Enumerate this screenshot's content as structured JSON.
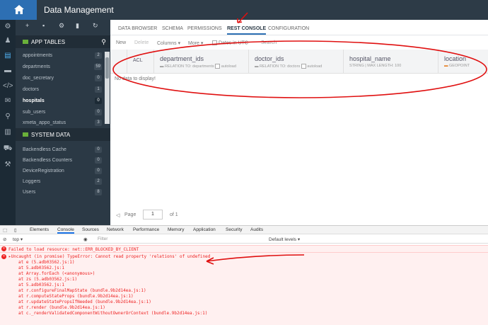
{
  "header": {
    "title": "Data Management"
  },
  "panel": {
    "app_tables_label": "APP TABLES",
    "tables": [
      {
        "name": "appointments",
        "count": "2"
      },
      {
        "name": "departments",
        "count": "59"
      },
      {
        "name": "doc_secretary",
        "count": "0"
      },
      {
        "name": "doctors",
        "count": "1"
      },
      {
        "name": "hospitals",
        "count": "0"
      },
      {
        "name": "sub_users",
        "count": "0"
      },
      {
        "name": "xmeta_appo_status",
        "count": "3"
      }
    ],
    "system_data_label": "SYSTEM DATA",
    "system": [
      {
        "name": "Backendless Cache",
        "count": "0"
      },
      {
        "name": "Backendless Counters",
        "count": "0"
      },
      {
        "name": "DeviceRegistration",
        "count": "0"
      },
      {
        "name": "Loggers",
        "count": "2"
      },
      {
        "name": "Users",
        "count": "8"
      }
    ]
  },
  "tabs": [
    "DATA BROWSER",
    "SCHEMA",
    "PERMISSIONS",
    "REST CONSOLE",
    "CONFIGURATION"
  ],
  "toolbar": {
    "new": "New",
    "delete": "Delete",
    "columns": "Columns",
    "more": "More",
    "dates_utc": "Dates in UTC",
    "search": "Search"
  },
  "grid": {
    "acl": "ACL",
    "cols": [
      {
        "name": "department_ids",
        "sub": "RELATION TO: departments",
        "autoload": "autoload"
      },
      {
        "name": "doctor_ids",
        "sub": "RELATION TO: doctors",
        "autoload": "autoload"
      },
      {
        "name": "hospital_name",
        "sub": "STRING | MAX LENGTH: 100",
        "autoload": ""
      },
      {
        "name": "location",
        "sub": "GEOPOINT",
        "autoload": ""
      }
    ],
    "empty": "No data to display!"
  },
  "pager": {
    "page_label": "Page",
    "page_value": "1",
    "of_label": "of 1"
  },
  "devtools": {
    "tabs": [
      "Elements",
      "Console",
      "Sources",
      "Network",
      "Performance",
      "Memory",
      "Application",
      "Security",
      "Audits"
    ],
    "context": "top",
    "filter": "Filter",
    "levels": "Default levels",
    "err1": "Failed to load resource: net::ERR_BLOCKED_BY_CLIENT",
    "err2": "▸Uncaught (in promise) TypeError: Cannot read property 'relations' of undefined",
    "stack": [
      "at e (5.adb03562.js:1)",
      "at 5.adb03562.js:1",
      "at Array.forEach (<anonymous>)",
      "at zs (5.adb03562.js:1)",
      "at 5.adb03562.js:1",
      "at r.configureFinalMapState (bundle.9b2d14ea.js:1)",
      "at r.computeStateProps (bundle.9b2d14ea.js:1)",
      "at r.updateStatePropsIfNeeded (bundle.9b2d14ea.js:1)",
      "at r.render (bundle.9b2d14ea.js:1)",
      "at c._renderValidatedComponentWithoutOwnerOrContext (bundle.9b2d14ea.js:1)"
    ]
  }
}
